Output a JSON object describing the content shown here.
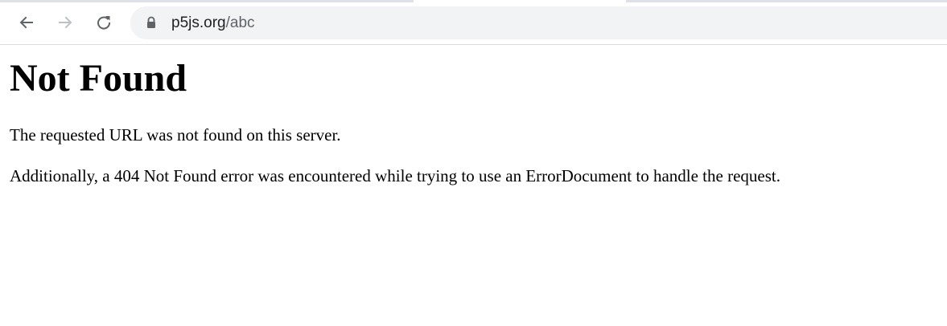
{
  "browser": {
    "url_host": "p5js.org",
    "url_path": "/abc",
    "icons": {
      "back": "arrow-left-icon",
      "forward": "arrow-right-icon",
      "reload": "reload-icon",
      "lock": "lock-icon"
    },
    "colors": {
      "toolbar_bg": "#ffffff",
      "omnibox_bg": "#f1f3f4",
      "icon_active": "#5f6368",
      "icon_disabled": "#bdc1c6"
    }
  },
  "page": {
    "title": "Not Found",
    "paragraphs": [
      "The requested URL was not found on this server.",
      "Additionally, a 404 Not Found error was encountered while trying to use an ErrorDocument to handle the request."
    ]
  }
}
